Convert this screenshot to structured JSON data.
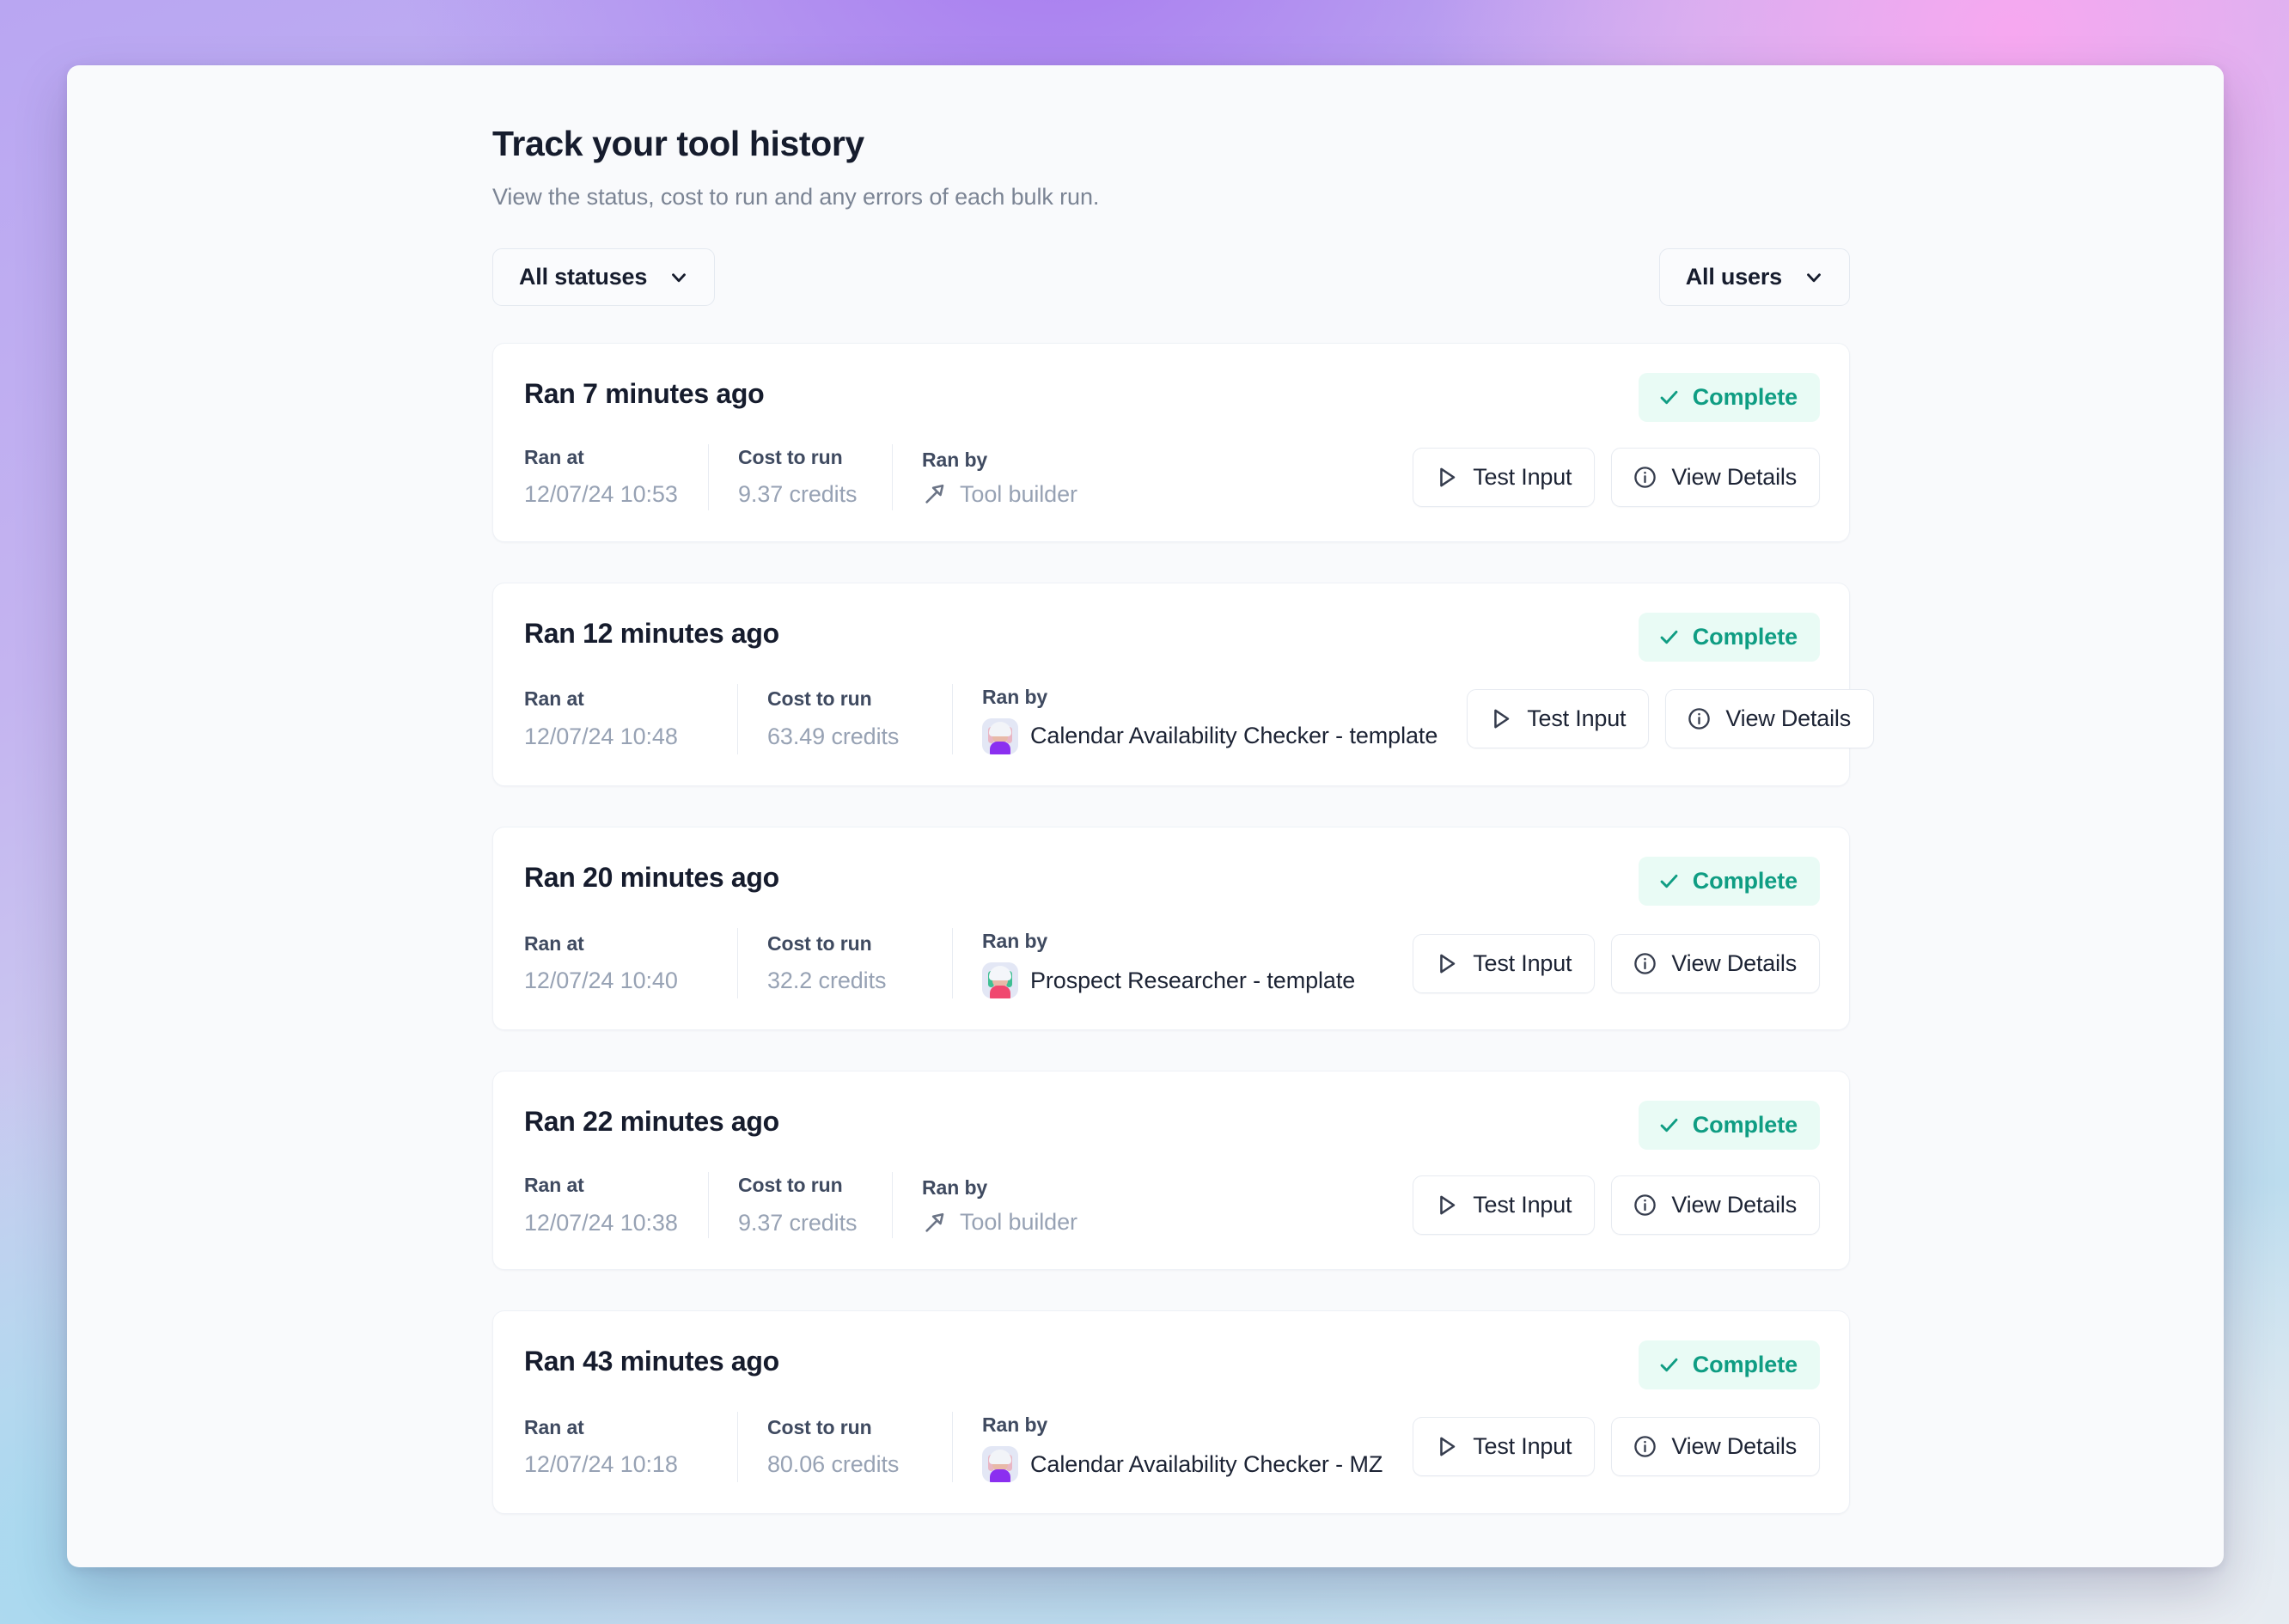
{
  "header": {
    "title": "Track your tool history",
    "subtitle": "View the status, cost to run and any errors of each bulk run."
  },
  "filters": {
    "status": {
      "label": "All statuses",
      "icon": "chevron-down-icon"
    },
    "users": {
      "label": "All users",
      "icon": "chevron-down-icon"
    }
  },
  "labels": {
    "ran_at": "Ran at",
    "cost_to_run": "Cost to run",
    "ran_by": "Ran by",
    "test_input": "Test Input",
    "view_details": "View Details",
    "status_complete": "Complete"
  },
  "colors": {
    "status_text": "#0f9d83",
    "status_bg": "#e9fbf5",
    "title": "#161c2d",
    "muted": "#97a2b4",
    "label": "#3f4a60",
    "card_border": "#eef1f6"
  },
  "runs": [
    {
      "title": "Ran 7 minutes ago",
      "status": "Complete",
      "ran_at_label": "Ran at",
      "ran_at": "12/07/24 10:53",
      "cost_label": "Cost to run",
      "cost": "9.37 credits",
      "ran_by_label": "Ran by",
      "ran_by": "Tool builder",
      "ran_by_icon": "tool-builder-icon",
      "test_input": "Test Input",
      "view_details": "View Details"
    },
    {
      "title": "Ran 12 minutes ago",
      "status": "Complete",
      "ran_at_label": "Ran at",
      "ran_at": "12/07/24 10:48",
      "cost_label": "Cost to run",
      "cost": "63.49 credits",
      "ran_by_label": "Ran by",
      "ran_by": "Calendar Availability Checker - template",
      "ran_by_icon": "avatar",
      "test_input": "Test Input",
      "view_details": "View Details"
    },
    {
      "title": "Ran 20 minutes ago",
      "status": "Complete",
      "ran_at_label": "Ran at",
      "ran_at": "12/07/24 10:40",
      "cost_label": "Cost to run",
      "cost": "32.2 credits",
      "ran_by_label": "Ran by",
      "ran_by": "Prospect Researcher - template",
      "ran_by_icon": "avatar",
      "test_input": "Test Input",
      "view_details": "View Details"
    },
    {
      "title": "Ran 22 minutes ago",
      "status": "Complete",
      "ran_at_label": "Ran at",
      "ran_at": "12/07/24 10:38",
      "cost_label": "Cost to run",
      "cost": "9.37 credits",
      "ran_by_label": "Ran by",
      "ran_by": "Tool builder",
      "ran_by_icon": "tool-builder-icon",
      "test_input": "Test Input",
      "view_details": "View Details"
    },
    {
      "title": "Ran 43 minutes ago",
      "status": "Complete",
      "ran_at_label": "Ran at",
      "ran_at": "12/07/24 10:18",
      "cost_label": "Cost to run",
      "cost": "80.06 credits",
      "ran_by_label": "Ran by",
      "ran_by": "Calendar Availability Checker - MZ",
      "ran_by_icon": "avatar",
      "test_input": "Test Input",
      "view_details": "View Details"
    }
  ]
}
